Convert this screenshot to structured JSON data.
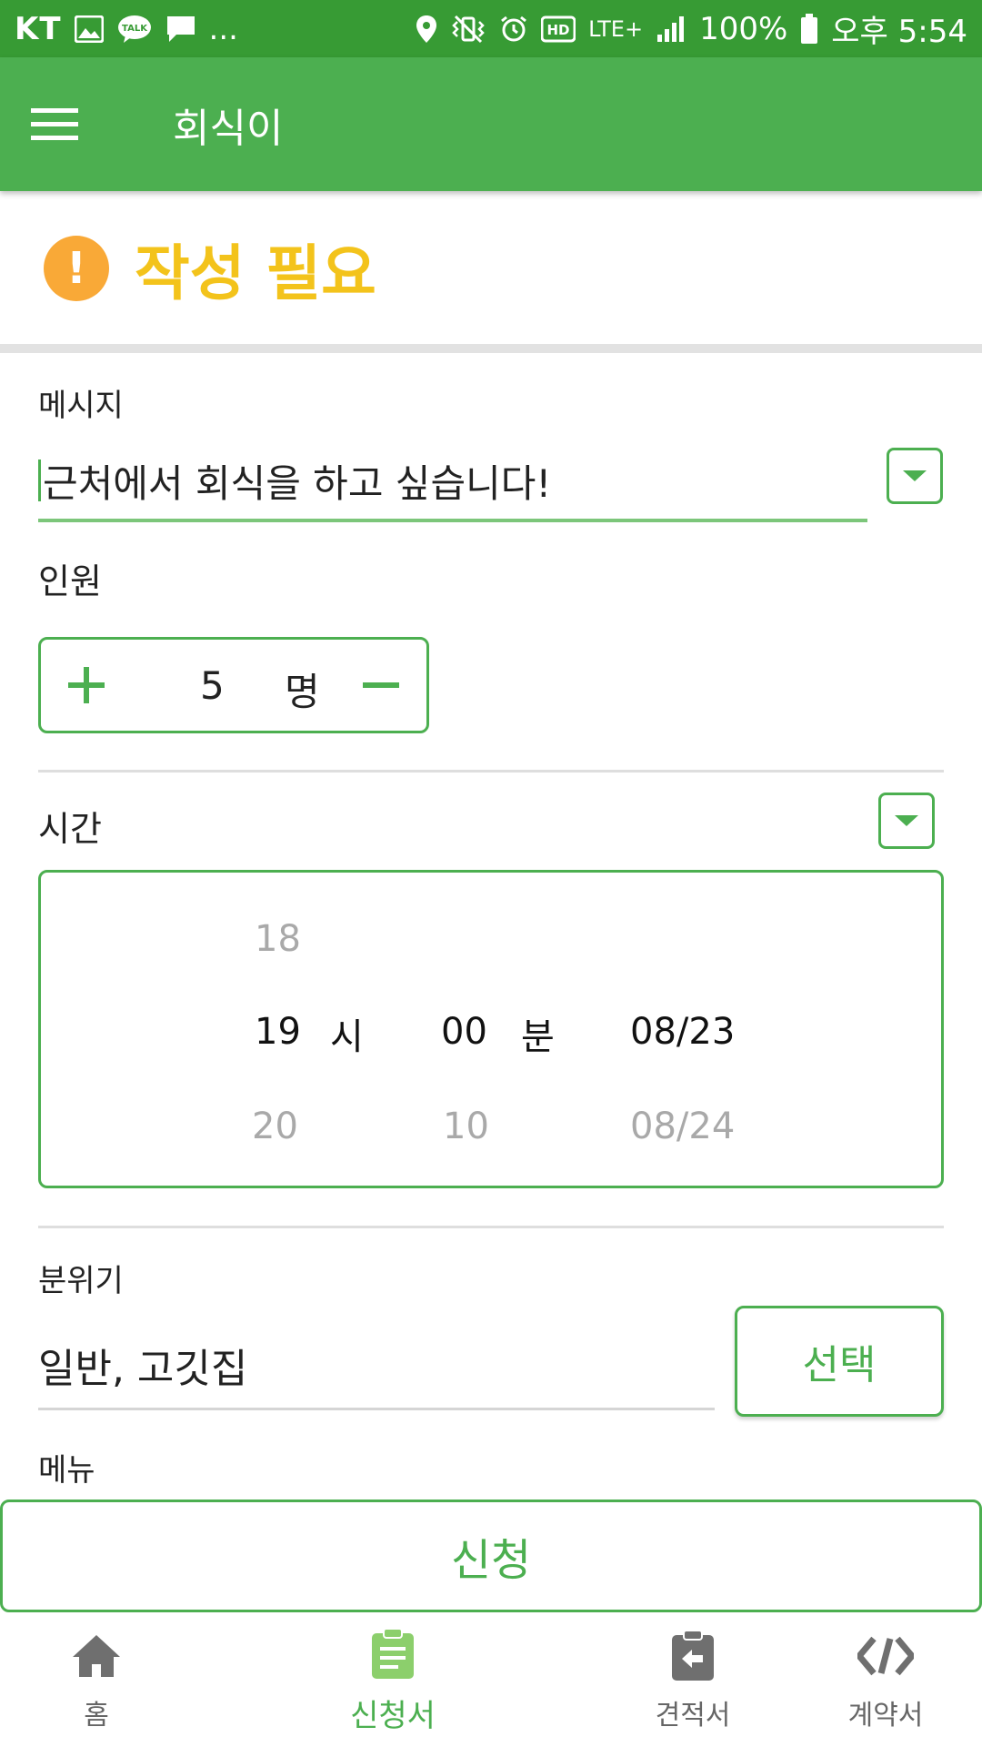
{
  "status_bar": {
    "carrier": "KT",
    "more": "...",
    "network": "LTE+",
    "battery": "100%",
    "time": "오후 5:54"
  },
  "app_bar": {
    "title": "회식이"
  },
  "warning": {
    "text": "작성 필요",
    "icon": "!"
  },
  "message": {
    "label": "메시지",
    "value": "근처에서 회식을 하고 싶습니다!"
  },
  "people": {
    "label": "인원",
    "plus": "+",
    "value": "5",
    "unit": "명",
    "minus": "−"
  },
  "time": {
    "label": "시간",
    "hour_prev": "18",
    "hour": "19",
    "hour_unit": "시",
    "hour_next": "20",
    "minute": "00",
    "minute_unit": "분",
    "minute_next": "10",
    "date": "08/23",
    "date_next": "08/24"
  },
  "atmosphere": {
    "label": "분위기",
    "value": "일반, 고깃집",
    "select_label": "선택"
  },
  "menu": {
    "label": "메뉴"
  },
  "submit": {
    "label": "신청"
  },
  "bottom_nav": [
    {
      "label": "홈",
      "icon": "home-icon"
    },
    {
      "label": "신청서",
      "icon": "clipboard-icon"
    },
    {
      "label": "견적서",
      "icon": "clipboard-arrow-icon"
    },
    {
      "label": "계약서",
      "icon": "contract-icon"
    }
  ],
  "colors": {
    "status_bar": "#379b34",
    "primary": "#4caf50",
    "warning_text": "#f3c31b",
    "warning_icon": "#f9a937"
  }
}
